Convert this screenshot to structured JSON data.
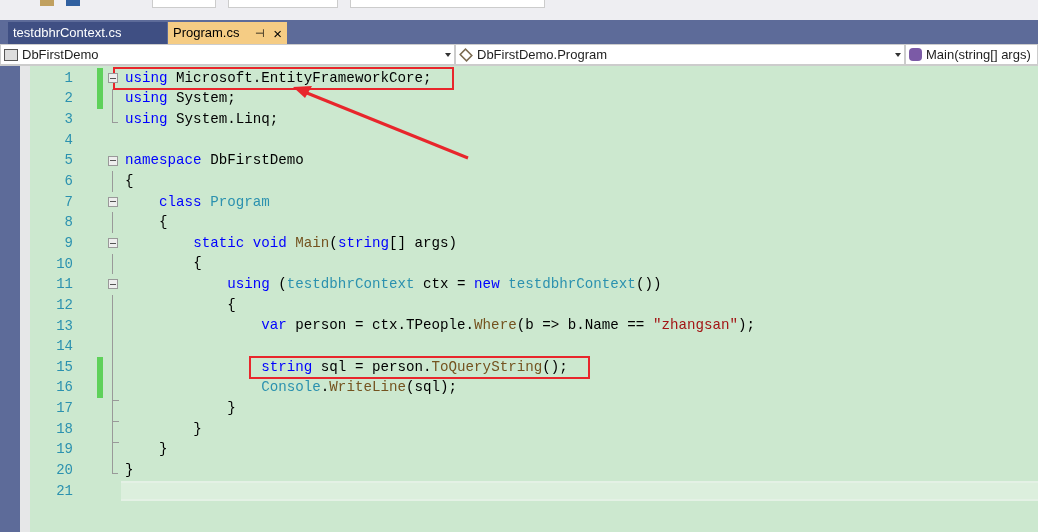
{
  "tabs": [
    {
      "label": "testdbhrContext.cs",
      "selected": false
    },
    {
      "label": "Program.cs",
      "selected": true,
      "pin": "⊣",
      "close": "×"
    }
  ],
  "nav_bar": {
    "project": "DbFirstDemo",
    "class": "DbFirstDemo.Program",
    "member": "Main(string[] args)"
  },
  "editor": {
    "lines": [
      {
        "number": "1",
        "changed": true,
        "kind": "fold-start",
        "highlighted": true,
        "current": false,
        "tokens": [
          {
            "kind": "keyword",
            "text": "using"
          },
          {
            "kind": "plain",
            "text": " Microsoft.EntityFrameworkCore;"
          }
        ]
      },
      {
        "number": "2",
        "changed": true,
        "kind": "fold-line",
        "highlighted": false,
        "current": false,
        "tokens": [
          {
            "kind": "keyword",
            "text": "using"
          },
          {
            "kind": "plain",
            "text": " System;"
          }
        ]
      },
      {
        "number": "3",
        "changed": false,
        "kind": "fold-end",
        "highlighted": false,
        "current": false,
        "tokens": [
          {
            "kind": "keyword",
            "text": "using"
          },
          {
            "kind": "plain",
            "text": " System.Linq;"
          }
        ]
      },
      {
        "number": "4",
        "changed": false,
        "kind": "plain",
        "highlighted": false,
        "current": false
      },
      {
        "number": "5",
        "changed": false,
        "kind": "fold-start",
        "highlighted": false,
        "current": false,
        "tokens": [
          {
            "kind": "keyword",
            "text": "namespace"
          },
          {
            "kind": "plain",
            "text": " DbFirstDemo"
          }
        ]
      },
      {
        "number": "6",
        "changed": false,
        "kind": "fold-line",
        "highlighted": false,
        "current": false,
        "tokens": [
          {
            "kind": "plain",
            "text": "{"
          }
        ]
      },
      {
        "number": "7",
        "changed": false,
        "kind": "fold-start",
        "highlighted": false,
        "current": false,
        "tokens": [
          {
            "kind": "keyword",
            "text": "    class"
          },
          {
            "kind": "type",
            "text": " Program"
          }
        ]
      },
      {
        "number": "8",
        "changed": false,
        "kind": "fold-line",
        "highlighted": false,
        "current": false,
        "tokens": [
          {
            "kind": "plain",
            "text": "    {"
          }
        ]
      },
      {
        "number": "9",
        "changed": false,
        "kind": "fold-start",
        "highlighted": false,
        "current": false,
        "tokens": [
          {
            "kind": "keyword",
            "text": "        static void"
          },
          {
            "kind": "method",
            "text": " Main"
          },
          {
            "kind": "plain",
            "text": "("
          },
          {
            "kind": "keyword",
            "text": "string"
          },
          {
            "kind": "plain",
            "text": "[] args)"
          }
        ]
      },
      {
        "number": "10",
        "changed": false,
        "kind": "fold-line",
        "highlighted": false,
        "current": false,
        "tokens": [
          {
            "kind": "plain",
            "text": "        {"
          }
        ]
      },
      {
        "number": "11",
        "changed": false,
        "kind": "fold-start",
        "highlighted": false,
        "current": false,
        "tokens": [
          {
            "kind": "keyword",
            "text": "            using"
          },
          {
            "kind": "plain",
            "text": " ("
          },
          {
            "kind": "type",
            "text": "testdbhrContext"
          },
          {
            "kind": "plain",
            "text": " ctx = "
          },
          {
            "kind": "keyword",
            "text": "new"
          },
          {
            "kind": "type",
            "text": " testdbhrContext"
          },
          {
            "kind": "plain",
            "text": "())"
          }
        ]
      },
      {
        "number": "12",
        "changed": false,
        "kind": "fold-line",
        "highlighted": false,
        "current": false,
        "tokens": [
          {
            "kind": "plain",
            "text": "            {"
          }
        ]
      },
      {
        "number": "13",
        "changed": false,
        "kind": "fold-line",
        "highlighted": false,
        "current": false,
        "tokens": [
          {
            "kind": "keyword",
            "text": "                var"
          },
          {
            "kind": "plain",
            "text": " person = ctx.TPeople."
          },
          {
            "kind": "method",
            "text": "Where"
          },
          {
            "kind": "plain",
            "text": "(b => b.Name == "
          },
          {
            "kind": "string",
            "text": "\"zhangsan\""
          },
          {
            "kind": "plain",
            "text": ");"
          }
        ]
      },
      {
        "number": "14",
        "changed": false,
        "kind": "fold-line",
        "highlighted": false,
        "current": false
      },
      {
        "number": "15",
        "changed": true,
        "kind": "fold-line",
        "highlighted": true,
        "current": false,
        "tokens": [
          {
            "kind": "keyword",
            "text": "                string"
          },
          {
            "kind": "plain",
            "text": " sql = person."
          },
          {
            "kind": "method",
            "text": "ToQueryString"
          },
          {
            "kind": "plain",
            "text": "();"
          }
        ]
      },
      {
        "number": "16",
        "changed": true,
        "kind": "fold-line",
        "highlighted": false,
        "current": false,
        "tokens": [
          {
            "kind": "type",
            "text": "                Console"
          },
          {
            "kind": "plain",
            "text": "."
          },
          {
            "kind": "method",
            "text": "WriteLine"
          },
          {
            "kind": "plain",
            "text": "(sql);"
          }
        ]
      },
      {
        "number": "17",
        "changed": false,
        "kind": "fold-tick",
        "highlighted": false,
        "current": false,
        "tokens": [
          {
            "kind": "plain",
            "text": "            }"
          }
        ]
      },
      {
        "number": "18",
        "changed": false,
        "kind": "fold-tick",
        "highlighted": false,
        "current": false,
        "tokens": [
          {
            "kind": "plain",
            "text": "        }"
          }
        ]
      },
      {
        "number": "19",
        "changed": false,
        "kind": "fold-tick",
        "highlighted": false,
        "current": false,
        "tokens": [
          {
            "kind": "plain",
            "text": "    }"
          }
        ]
      },
      {
        "number": "20",
        "changed": false,
        "kind": "fold-end",
        "highlighted": false,
        "current": false,
        "tokens": [
          {
            "kind": "plain",
            "text": "}"
          }
        ]
      },
      {
        "number": "21",
        "changed": false,
        "kind": "plain",
        "highlighted": false,
        "current": true
      }
    ]
  }
}
